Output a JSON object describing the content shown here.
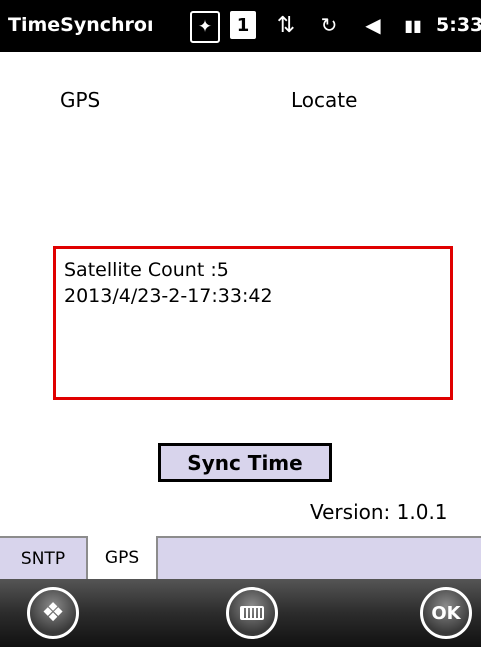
{
  "status_bar": {
    "app_title": "TimeSynchroı",
    "sim_indicator": "1",
    "time": "5:33",
    "icons": [
      "bluetooth-icon",
      "sim-icon",
      "network-activity-icon",
      "sync-icon",
      "volume-icon",
      "battery-icon"
    ]
  },
  "main": {
    "gps_label": "GPS",
    "locate_label": "Locate",
    "info": {
      "satellite_count": "Satellite Count :5",
      "timestamp": "2013/4/23-2-17:33:42"
    },
    "sync_button": "Sync Time",
    "version": "Version: 1.0.1"
  },
  "tabs": [
    {
      "label": "SNTP",
      "active": false
    },
    {
      "label": "GPS",
      "active": true
    }
  ],
  "softkeys": {
    "start": "start-icon",
    "keyboard": "keyboard-icon",
    "ok": "OK"
  },
  "colors": {
    "highlight_border": "#e00000",
    "button_fill": "#d8d4ec",
    "status_bar": "#000000"
  }
}
